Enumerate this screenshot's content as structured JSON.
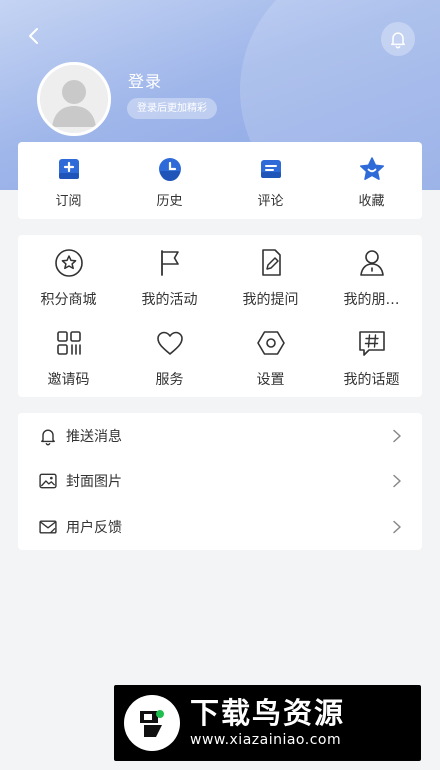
{
  "header": {
    "login_title": "登录",
    "login_subtitle": "登录后更加精彩",
    "gradient_start": "#c5d4f3",
    "gradient_end": "#8aa5e4"
  },
  "icons": {
    "back": "chevron-left-icon",
    "bell": "bell-icon"
  },
  "quick_actions": [
    {
      "label": "订阅",
      "icon": "subscribe-icon"
    },
    {
      "label": "历史",
      "icon": "history-clock-icon"
    },
    {
      "label": "评论",
      "icon": "comment-icon"
    },
    {
      "label": "收藏",
      "icon": "star-favorite-icon"
    }
  ],
  "quick_icon_color": "#2f6bd8",
  "grid_items": [
    {
      "label": "积分商城",
      "icon": "star-circle-icon"
    },
    {
      "label": "我的活动",
      "icon": "flag-icon"
    },
    {
      "label": "我的提问",
      "icon": "edit-document-icon"
    },
    {
      "label": "我的朋…",
      "icon": "person-icon"
    },
    {
      "label": "邀请码",
      "icon": "qr-code-icon"
    },
    {
      "label": "服务",
      "icon": "heart-icon"
    },
    {
      "label": "设置",
      "icon": "settings-eye-icon"
    },
    {
      "label": "我的话题",
      "icon": "hashtag-icon"
    }
  ],
  "list_items": [
    {
      "label": "推送消息",
      "icon": "bell-outline-icon"
    },
    {
      "label": "封面图片",
      "icon": "image-icon"
    },
    {
      "label": "用户反馈",
      "icon": "feedback-mail-icon"
    }
  ],
  "watermark": {
    "title": "下载鸟资源",
    "url": "www.xiazainiao.com"
  }
}
